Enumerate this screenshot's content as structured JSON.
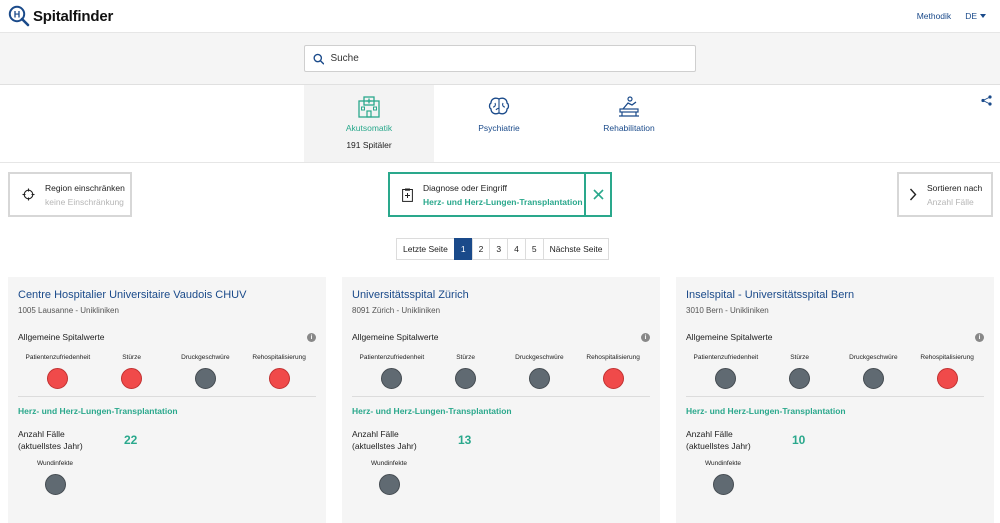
{
  "header": {
    "logo_letter": "H",
    "logo_text": "Spitalfinder",
    "methodik": "Methodik",
    "language": "DE"
  },
  "search": {
    "placeholder": "Suche"
  },
  "tabs": [
    {
      "label": "Akutsomatik",
      "count": "191 Spitäler",
      "icon": "hospital-icon",
      "active": true
    },
    {
      "label": "Psychiatrie",
      "count": "",
      "icon": "brain-icon",
      "active": false
    },
    {
      "label": "Rehabilitation",
      "count": "",
      "icon": "rehab-icon",
      "active": false
    }
  ],
  "filters": {
    "region": {
      "title": "Region einschränken",
      "value": "keine Einschränkung"
    },
    "diagnosis": {
      "title": "Diagnose oder Eingriff",
      "value": "Herz- und Herz-Lungen-Transplantation"
    },
    "sort": {
      "title": "Sortieren nach",
      "value": "Anzahl Fälle"
    }
  },
  "pagination": {
    "prev": "Letzte Seite",
    "pages": [
      "1",
      "2",
      "3",
      "4",
      "5"
    ],
    "current": "1",
    "next": "Nächste Seite"
  },
  "labels": {
    "general": "Allgemeine Spitalwerte",
    "metrics": [
      "Patientenzufriedenheit",
      "Stürze",
      "Druckgeschwüre",
      "Rehospitalisierung"
    ],
    "cases_line1": "Anzahl Fälle",
    "cases_line2": "(aktuellstes Jahr)",
    "wound": "Wundinfekte",
    "info": "i"
  },
  "hospitals": [
    {
      "name": "Centre Hospitalier Universitaire Vaudois CHUV",
      "location": "1005 Lausanne - Unikliniken",
      "metric_status": [
        "red",
        "red",
        "grey",
        "red"
      ],
      "procedure": "Herz- und Herz-Lungen-Transplantation",
      "cases": "22",
      "wound_status": "grey"
    },
    {
      "name": "Universitätsspital Zürich",
      "location": "8091 Zürich - Unikliniken",
      "metric_status": [
        "grey",
        "grey",
        "grey",
        "red"
      ],
      "procedure": "Herz- und Herz-Lungen-Transplantation",
      "cases": "13",
      "wound_status": "grey"
    },
    {
      "name": "Inselspital - Universitätsspital Bern",
      "location": "3010 Bern - Unikliniken",
      "metric_status": [
        "grey",
        "grey",
        "grey",
        "red"
      ],
      "procedure": "Herz- und Herz-Lungen-Transplantation",
      "cases": "10",
      "wound_status": "grey"
    }
  ],
  "colors": {
    "brand_blue": "#1a4a8a",
    "accent_green": "#2aa88c",
    "status_red": "#f04a4a",
    "status_grey": "#606a72"
  }
}
